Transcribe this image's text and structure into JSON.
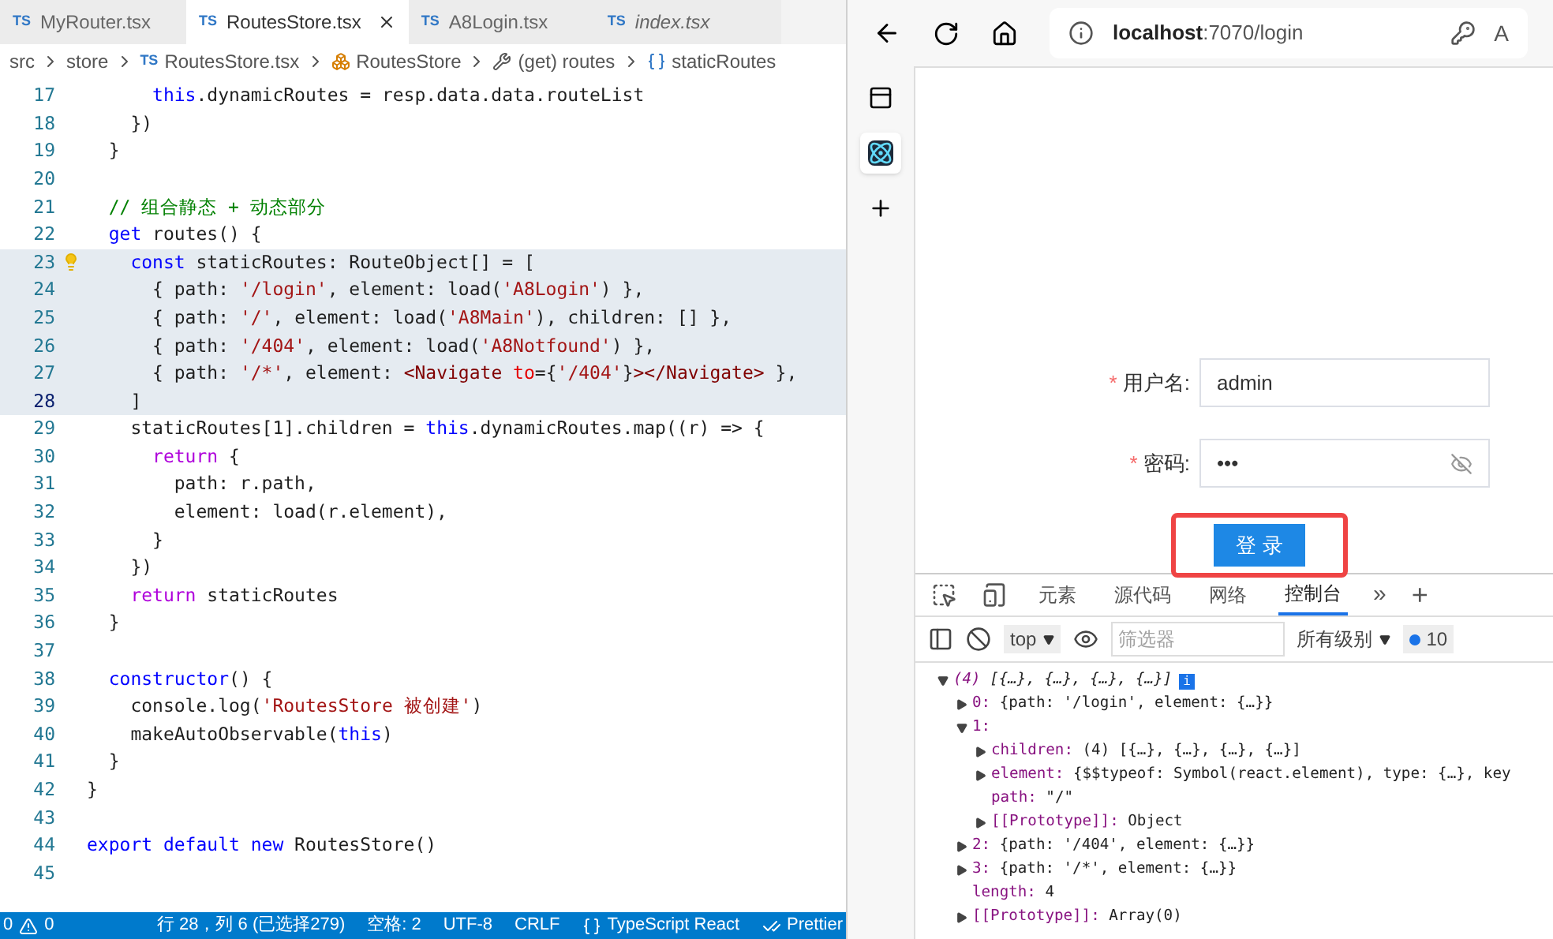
{
  "editor": {
    "tabs": [
      {
        "badge": "TS",
        "label": "MyRouter.tsx",
        "selected": false,
        "preview": false
      },
      {
        "badge": "TS",
        "label": "RoutesStore.tsx",
        "selected": true,
        "preview": false
      },
      {
        "badge": "TS",
        "label": "A8Login.tsx",
        "selected": false,
        "preview": false
      },
      {
        "badge": "TS",
        "label": "index.tsx",
        "selected": false,
        "preview": true
      }
    ],
    "breadcrumbs": [
      {
        "kind": "folder",
        "label": "src"
      },
      {
        "kind": "folder",
        "label": "store"
      },
      {
        "kind": "file",
        "badge": "TS",
        "label": "RoutesStore.tsx"
      },
      {
        "kind": "class",
        "label": "RoutesStore"
      },
      {
        "kind": "property",
        "label": "(get) routes"
      },
      {
        "kind": "variable",
        "label": "staticRoutes"
      }
    ],
    "lines": [
      {
        "number": "17",
        "selected": false,
        "current": false,
        "segments": [
          {
            "kind": "kw",
            "text": "      this"
          },
          {
            "kind": "plain",
            "text": ".dynamicRoutes = resp.data.data.routeList"
          }
        ]
      },
      {
        "number": "18",
        "selected": false,
        "current": false,
        "segments": [
          {
            "kind": "plain",
            "text": "    })"
          }
        ]
      },
      {
        "number": "19",
        "selected": false,
        "current": false,
        "segments": [
          {
            "kind": "plain",
            "text": "  }"
          }
        ]
      },
      {
        "number": "20",
        "selected": false,
        "current": false
      },
      {
        "number": "21",
        "selected": false,
        "current": false,
        "segments": [
          {
            "kind": "comment",
            "text": "  // 组合静态 + 动态部分"
          }
        ]
      },
      {
        "number": "22",
        "selected": false,
        "current": false,
        "segments": [
          {
            "kind": "kw",
            "text": "  get"
          },
          {
            "kind": "plain",
            "text": " routes() {"
          }
        ]
      },
      {
        "number": "23",
        "selected": true,
        "current": false,
        "hint": true,
        "segments": [
          {
            "kind": "kw",
            "text": "    const"
          },
          {
            "kind": "plain",
            "text": " staticRoutes: RouteObject[] = ["
          }
        ]
      },
      {
        "number": "24",
        "selected": true,
        "current": false,
        "segments": [
          {
            "kind": "plain",
            "text": "      { path: "
          },
          {
            "kind": "str",
            "text": "'/login'"
          },
          {
            "kind": "plain",
            "text": ", element: load("
          },
          {
            "kind": "str",
            "text": "'A8Login'"
          },
          {
            "kind": "plain",
            "text": ") },"
          }
        ]
      },
      {
        "number": "25",
        "selected": true,
        "current": false,
        "segments": [
          {
            "kind": "plain",
            "text": "      { path: "
          },
          {
            "kind": "str",
            "text": "'/'"
          },
          {
            "kind": "plain",
            "text": ", element: load("
          },
          {
            "kind": "str",
            "text": "'A8Main'"
          },
          {
            "kind": "plain",
            "text": "), children: [] },"
          }
        ]
      },
      {
        "number": "26",
        "selected": true,
        "current": false,
        "segments": [
          {
            "kind": "plain",
            "text": "      { path: "
          },
          {
            "kind": "str",
            "text": "'/404'"
          },
          {
            "kind": "plain",
            "text": ", element: load("
          },
          {
            "kind": "str",
            "text": "'A8Notfound'"
          },
          {
            "kind": "plain",
            "text": ") },"
          }
        ]
      },
      {
        "number": "27",
        "selected": true,
        "current": false,
        "segments": [
          {
            "kind": "plain",
            "text": "      { path: "
          },
          {
            "kind": "str",
            "text": "'/*'"
          },
          {
            "kind": "plain",
            "text": ", element: "
          },
          {
            "kind": "tag",
            "text": "<Navigate"
          },
          {
            "kind": "attr",
            "text": " to"
          },
          {
            "kind": "plain",
            "text": "={"
          },
          {
            "kind": "str",
            "text": "'/404'"
          },
          {
            "kind": "plain",
            "text": "}"
          },
          {
            "kind": "tag",
            "text": "></Navigate>"
          },
          {
            "kind": "plain",
            "text": " },"
          }
        ]
      },
      {
        "number": "28",
        "selected": true,
        "current": true,
        "segments": [
          {
            "kind": "plain",
            "text": "    ]"
          }
        ]
      },
      {
        "number": "29",
        "selected": false,
        "current": false,
        "segments": [
          {
            "kind": "plain",
            "text": "    staticRoutes[1].children = "
          },
          {
            "kind": "kw",
            "text": "this"
          },
          {
            "kind": "plain",
            "text": ".dynamicRoutes.map((r) => {"
          }
        ]
      },
      {
        "number": "30",
        "selected": false,
        "current": false,
        "segments": [
          {
            "kind": "ctrl",
            "text": "      return"
          },
          {
            "kind": "plain",
            "text": " {"
          }
        ]
      },
      {
        "number": "31",
        "selected": false,
        "current": false,
        "segments": [
          {
            "kind": "plain",
            "text": "        path: r.path,"
          }
        ]
      },
      {
        "number": "32",
        "selected": false,
        "current": false,
        "segments": [
          {
            "kind": "plain",
            "text": "        element: load(r.element),"
          }
        ]
      },
      {
        "number": "33",
        "selected": false,
        "current": false,
        "segments": [
          {
            "kind": "plain",
            "text": "      }"
          }
        ]
      },
      {
        "number": "34",
        "selected": false,
        "current": false,
        "segments": [
          {
            "kind": "plain",
            "text": "    })"
          }
        ]
      },
      {
        "number": "35",
        "selected": false,
        "current": false,
        "segments": [
          {
            "kind": "ctrl",
            "text": "    return"
          },
          {
            "kind": "plain",
            "text": " staticRoutes"
          }
        ]
      },
      {
        "number": "36",
        "selected": false,
        "current": false,
        "segments": [
          {
            "kind": "plain",
            "text": "  }"
          }
        ]
      },
      {
        "number": "37",
        "selected": false,
        "current": false
      },
      {
        "number": "38",
        "selected": false,
        "current": false,
        "segments": [
          {
            "kind": "kw",
            "text": "  constructor"
          },
          {
            "kind": "plain",
            "text": "() {"
          }
        ]
      },
      {
        "number": "39",
        "selected": false,
        "current": false,
        "segments": [
          {
            "kind": "plain",
            "text": "    console.log("
          },
          {
            "kind": "str",
            "text": "'RoutesStore 被创建'"
          },
          {
            "kind": "plain",
            "text": ")"
          }
        ]
      },
      {
        "number": "40",
        "selected": false,
        "current": false,
        "segments": [
          {
            "kind": "plain",
            "text": "    makeAutoObservable("
          },
          {
            "kind": "kw",
            "text": "this"
          },
          {
            "kind": "plain",
            "text": ")"
          }
        ]
      },
      {
        "number": "41",
        "selected": false,
        "current": false,
        "segments": [
          {
            "kind": "plain",
            "text": "  }"
          }
        ]
      },
      {
        "number": "42",
        "selected": false,
        "current": false,
        "segments": [
          {
            "kind": "plain",
            "text": "}"
          }
        ]
      },
      {
        "number": "43",
        "selected": false,
        "current": false
      },
      {
        "number": "44",
        "selected": false,
        "current": false,
        "segments": [
          {
            "kind": "kw",
            "text": "export default new"
          },
          {
            "kind": "plain",
            "text": " RoutesStore()"
          }
        ]
      },
      {
        "number": "45",
        "selected": false,
        "current": false
      }
    ],
    "status_bar": {
      "errors": "0",
      "warnings": "0",
      "items": [
        {
          "kind": "text",
          "label": "行 28，列 6 (已选择279)"
        },
        {
          "kind": "text",
          "label": "空格: 2"
        },
        {
          "kind": "text",
          "label": "UTF-8"
        },
        {
          "kind": "text",
          "label": "CRLF"
        },
        {
          "kind": "language",
          "label": "TypeScript React"
        },
        {
          "kind": "check",
          "label": "Prettier"
        }
      ]
    }
  },
  "browser": {
    "address": {
      "host": "localhost",
      "rest": ":7070/login"
    },
    "reader_label": "A",
    "form": {
      "fields": [
        {
          "kind": "text",
          "required_mark": "*",
          "label": "用户名:",
          "value": "admin"
        },
        {
          "kind": "password",
          "required_mark": "*",
          "label": "密码:",
          "value": "•••"
        }
      ],
      "submit": "登 录",
      "highlighted": true
    },
    "devtools": {
      "tabs": [
        {
          "label": "元素",
          "selected": false
        },
        {
          "label": "源代码",
          "selected": false
        },
        {
          "label": "网络",
          "selected": false
        },
        {
          "label": "控制台",
          "selected": true
        }
      ],
      "more": "»",
      "add": "+",
      "context": "top",
      "filter_placeholder": "筛选器",
      "levels": "所有级别",
      "message_count": "10",
      "console": [
        {
          "kind": "node",
          "key": "(4)",
          "value": "[{…}, {…}, {…}, {…}]",
          "expanded": true,
          "info": "i",
          "children": [
            {
              "kind": "node",
              "key": "0:",
              "value": "{path: '/login', element: {…}}",
              "expanded": false
            },
            {
              "kind": "node",
              "key": "1:",
              "expanded": true,
              "children": [
                {
                  "kind": "node",
                  "key": "children:",
                  "value": "(4) [{…}, {…}, {…}, {…}]",
                  "expanded": false
                },
                {
                  "kind": "node",
                  "key": "element:",
                  "value": "{$$typeof: Symbol(react.element), type: {…}, key",
                  "expanded": false
                },
                {
                  "kind": "leaf",
                  "key": "path:",
                  "value": "\"/\""
                },
                {
                  "kind": "node",
                  "key": "[[Prototype]]:",
                  "value": "Object",
                  "expanded": false
                }
              ]
            },
            {
              "kind": "node",
              "key": "2:",
              "value": "{path: '/404', element: {…}}",
              "expanded": false
            },
            {
              "kind": "node",
              "key": "3:",
              "value": "{path: '/*', element: {…}}",
              "expanded": false
            },
            {
              "kind": "leaf",
              "key": "length:",
              "value": "4"
            },
            {
              "kind": "node",
              "key": "[[Prototype]]:",
              "value": "Array(0)",
              "expanded": false
            }
          ]
        }
      ]
    }
  }
}
